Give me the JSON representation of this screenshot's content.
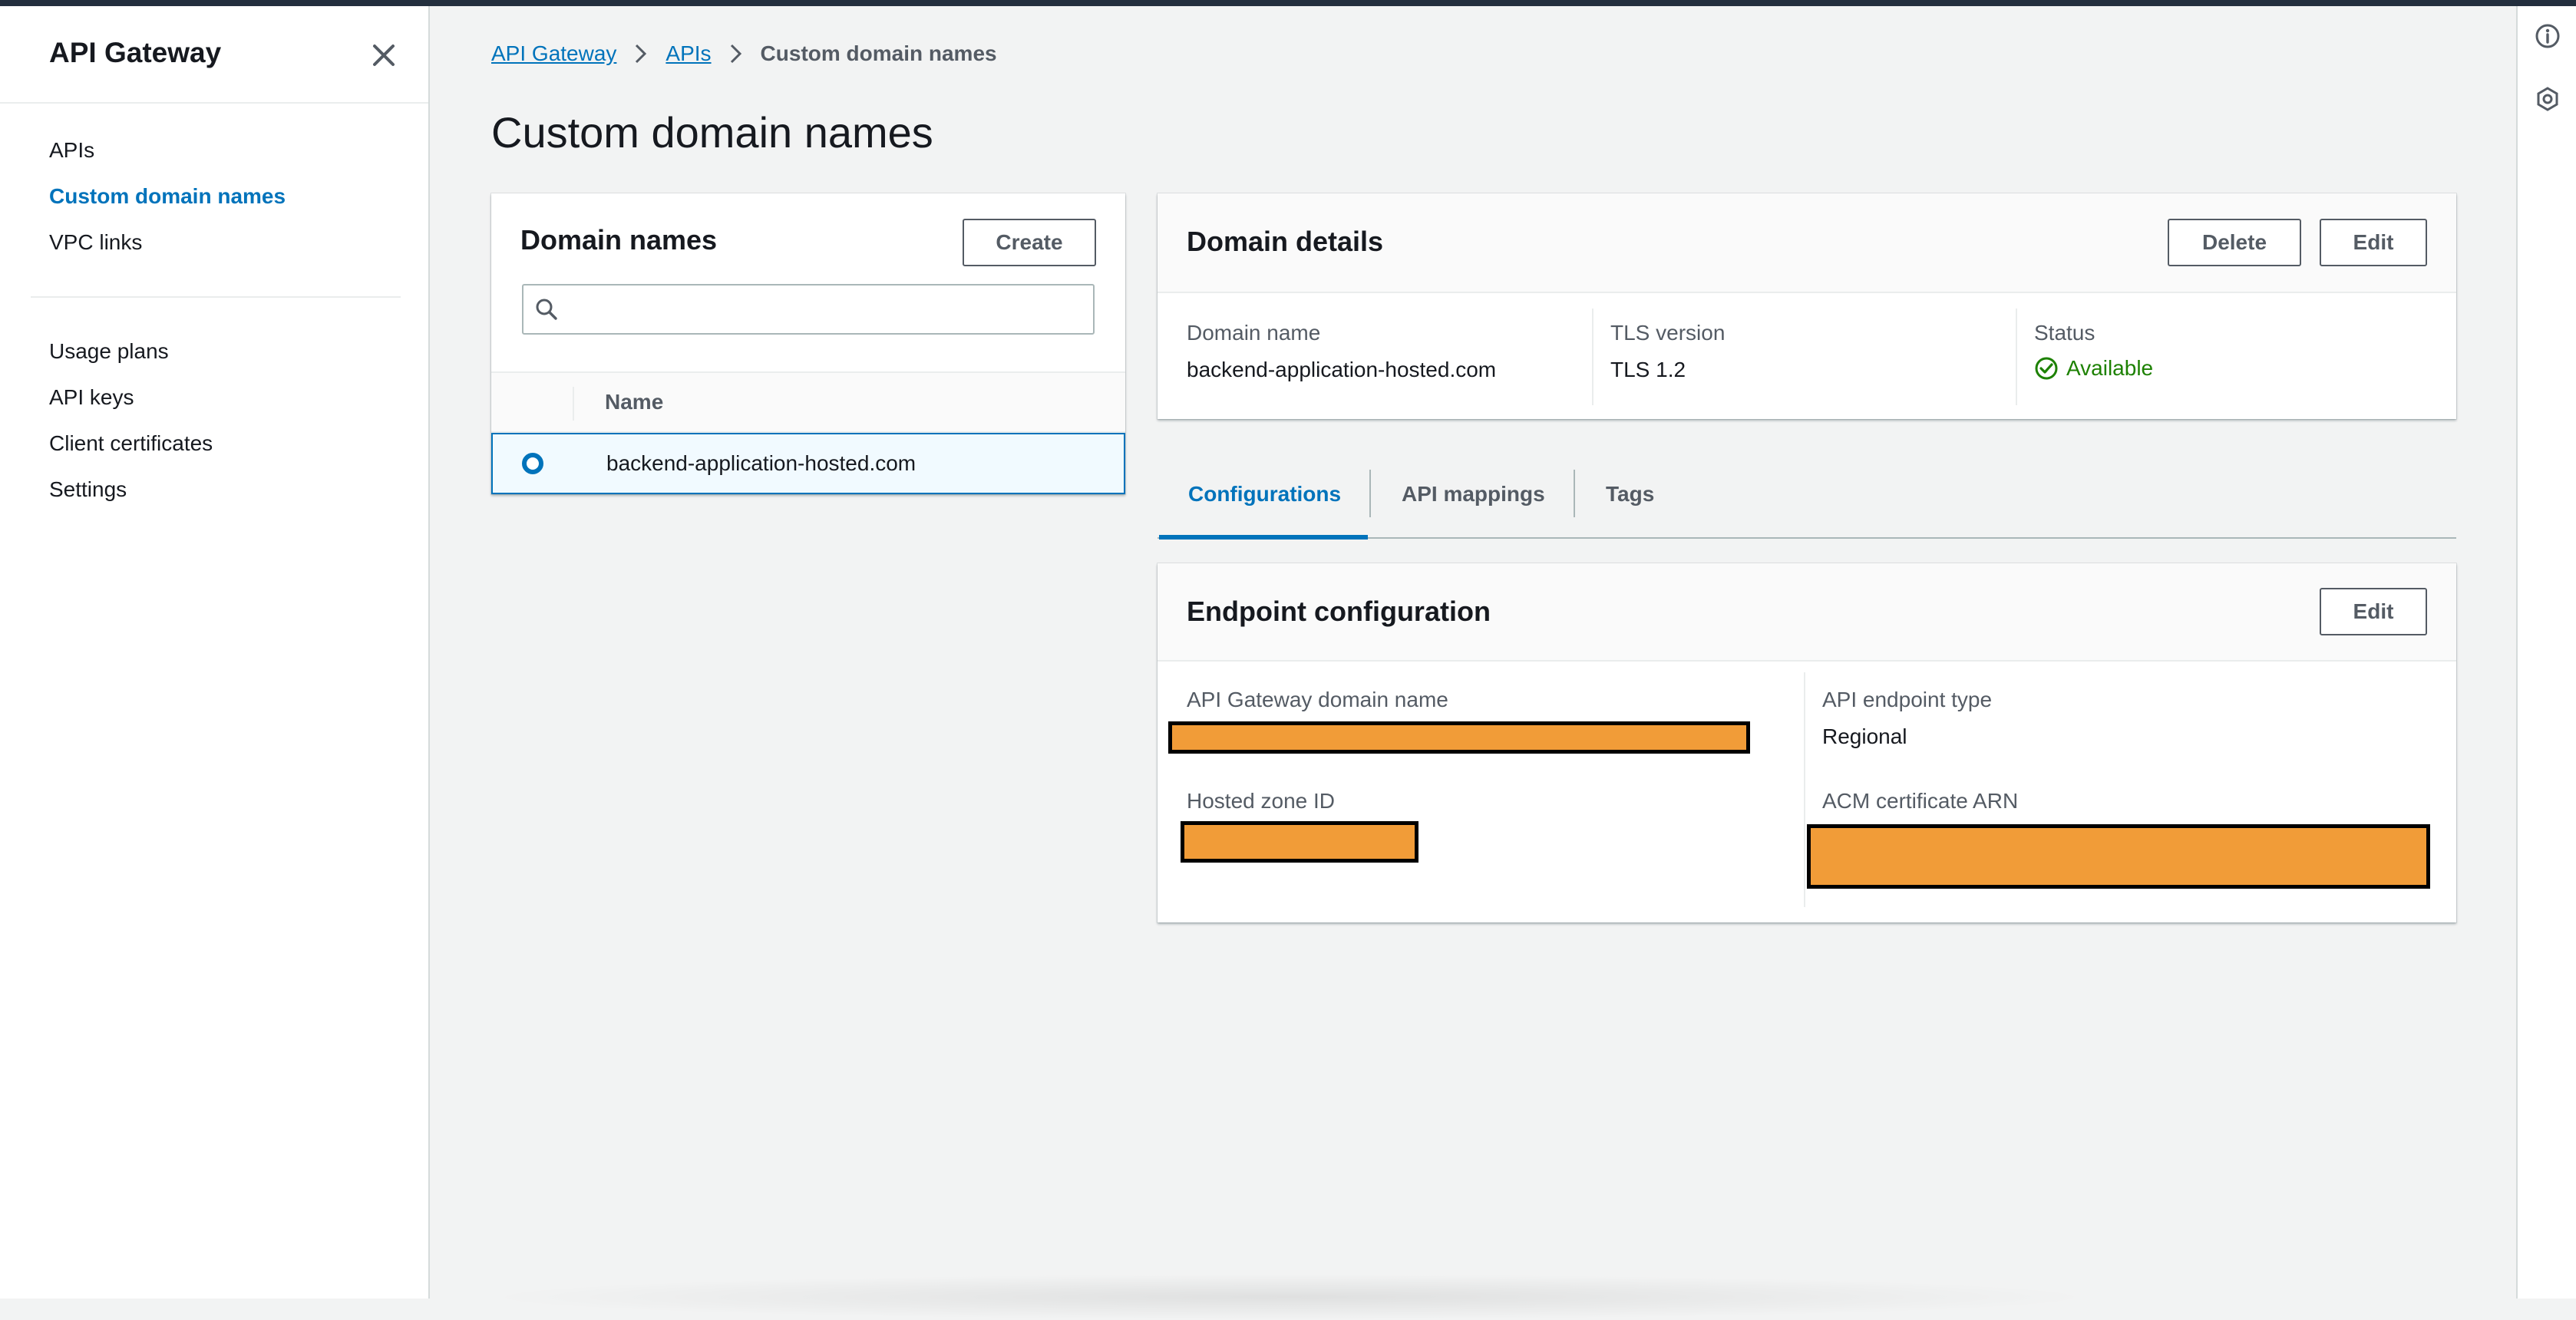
{
  "sidebar": {
    "title": "API Gateway",
    "items": [
      {
        "label": "APIs"
      },
      {
        "label": "Custom domain names"
      },
      {
        "label": "VPC links"
      },
      {
        "label": "Usage plans"
      },
      {
        "label": "API keys"
      },
      {
        "label": "Client certificates"
      },
      {
        "label": "Settings"
      }
    ]
  },
  "breadcrumb": [
    "API Gateway",
    "APIs",
    "Custom domain names"
  ],
  "page_title": "Custom domain names",
  "domain_names": {
    "title": "Domain names",
    "create_label": "Create",
    "search_placeholder": "",
    "column_name": "Name",
    "rows": [
      {
        "name": "backend-application-hosted.com"
      }
    ]
  },
  "domain_details": {
    "title": "Domain details",
    "delete_label": "Delete",
    "edit_label": "Edit",
    "domain_name_label": "Domain name",
    "domain_name_value": "backend-application-hosted.com",
    "tls_label": "TLS version",
    "tls_value": "TLS 1.2",
    "status_label": "Status",
    "status_value": "Available"
  },
  "tabs": [
    {
      "label": "Configurations"
    },
    {
      "label": "API mappings"
    },
    {
      "label": "Tags"
    }
  ],
  "endpoint_config": {
    "title": "Endpoint configuration",
    "edit_label": "Edit",
    "gateway_domain_label": "API Gateway domain name",
    "endpoint_type_label": "API endpoint type",
    "endpoint_type_value": "Regional",
    "hosted_zone_label": "Hosted zone ID",
    "acm_label": "ACM certificate ARN"
  },
  "colors": {
    "accent": "#0073bb",
    "status_green": "#1d8102",
    "redaction": "#f19c38"
  }
}
